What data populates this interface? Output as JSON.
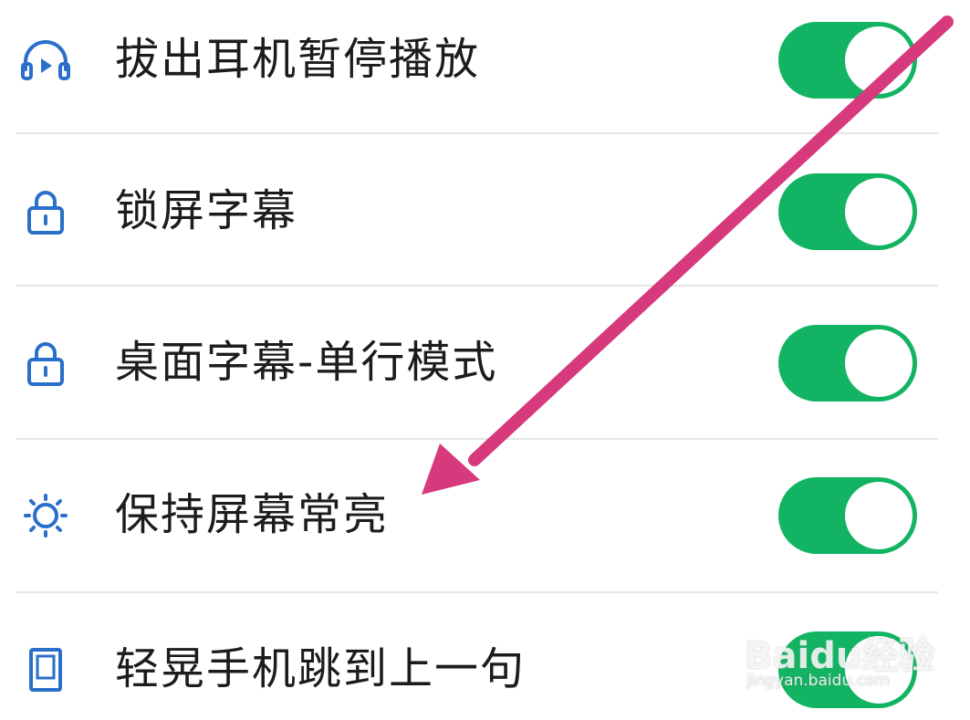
{
  "settings": {
    "items": [
      {
        "label": "拔出耳机暂停播放",
        "icon": "headphones-play-icon",
        "enabled": true
      },
      {
        "label": "锁屏字幕",
        "icon": "lock-icon",
        "enabled": true
      },
      {
        "label": "桌面字幕-单行模式",
        "icon": "lock-icon",
        "enabled": true
      },
      {
        "label": "保持屏幕常亮",
        "icon": "sun-icon",
        "enabled": true
      },
      {
        "label": "轻晃手机跳到上一句",
        "icon": "phone-frame-icon",
        "enabled": true
      }
    ]
  },
  "colors": {
    "toggle_on": "#12b463",
    "icon_blue": "#2a6fc9",
    "arrow": "#d63a7c",
    "divider": "#e6e6e6"
  },
  "watermark": {
    "logo": "Baidu经验",
    "url": "jingyan.baidu.com"
  }
}
